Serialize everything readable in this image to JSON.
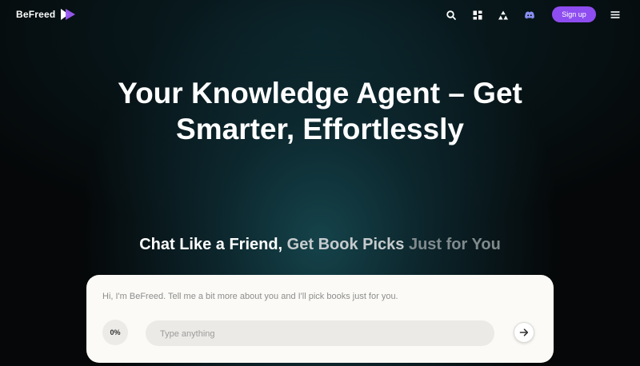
{
  "header": {
    "brand": "BeFreed",
    "logo_icon": "play-triangles-icon",
    "nav_icons": [
      "search-icon",
      "grid-icon",
      "triangle-shapes-icon",
      "discord-icon"
    ],
    "signup_label": "Sign up",
    "menu_icon": "hamburger-menu-icon"
  },
  "hero": {
    "title_line1": "Your Knowledge Agent – Get",
    "title_line2": "Smarter, Effortlessly",
    "subtitle_part1": "Chat Like a Friend,",
    "subtitle_part2": " Get Book Picks",
    "subtitle_part3": " Just for You"
  },
  "chat": {
    "prompt": "Hi, I'm BeFreed. Tell me a bit more about you and I'll pick books just for you.",
    "progress": "0%",
    "input_placeholder": "Type anything",
    "input_value": "",
    "send_icon": "arrow-right-icon"
  },
  "colors": {
    "accent": "#8e4df0",
    "logo_light": "#ffffff",
    "logo_purple": "#9b5cf5",
    "background": "#050708",
    "card": "#fbfaf6"
  }
}
